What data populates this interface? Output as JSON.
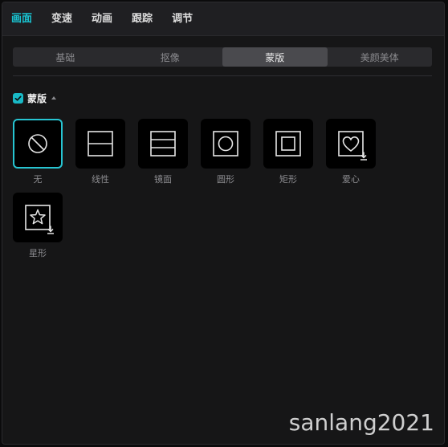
{
  "top_tabs": [
    {
      "label": "画面"
    },
    {
      "label": "变速"
    },
    {
      "label": "动画"
    },
    {
      "label": "跟踪"
    },
    {
      "label": "调节"
    }
  ],
  "active_top_tab": "画面",
  "sub_tabs": [
    {
      "label": "基础"
    },
    {
      "label": "抠像"
    },
    {
      "label": "蒙版"
    },
    {
      "label": "美颜美体"
    }
  ],
  "active_sub_tab": "蒙版",
  "section": {
    "title": "蒙版",
    "checked": true
  },
  "masks": [
    {
      "label": "无",
      "icon": "none-icon",
      "selected": true,
      "downloadable": false
    },
    {
      "label": "线性",
      "icon": "linear-icon",
      "selected": false,
      "downloadable": false
    },
    {
      "label": "镜面",
      "icon": "mirror-icon",
      "selected": false,
      "downloadable": false
    },
    {
      "label": "圆形",
      "icon": "circle-icon",
      "selected": false,
      "downloadable": false
    },
    {
      "label": "矩形",
      "icon": "rectangle-icon",
      "selected": false,
      "downloadable": false
    },
    {
      "label": "爱心",
      "icon": "heart-icon",
      "selected": false,
      "downloadable": true
    },
    {
      "label": "星形",
      "icon": "star-icon",
      "selected": false,
      "downloadable": true
    }
  ],
  "colors": {
    "accent": "#19c3d1",
    "panel": "#161617",
    "tile": "#000000"
  },
  "watermark": "sanlang2021"
}
